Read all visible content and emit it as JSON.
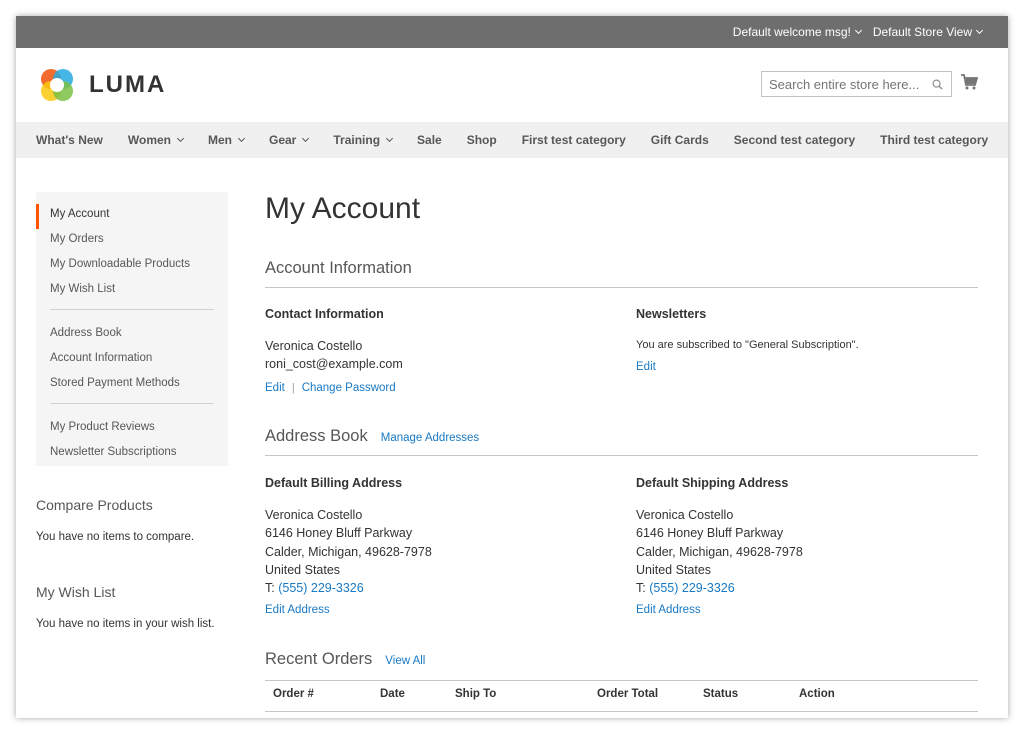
{
  "colors": {
    "accent": "#ff5501",
    "link": "#1979c3",
    "top_bar": "#6e6e6e",
    "nav_bg": "#f0f0f0"
  },
  "top_bar": {
    "welcome": "Default welcome msg!",
    "store_view": "Default Store View"
  },
  "brand": {
    "name": "LUMA"
  },
  "search": {
    "placeholder": "Search entire store here..."
  },
  "nav": [
    "What's New",
    "Women",
    "Men",
    "Gear",
    "Training",
    "Sale",
    "Shop",
    "First test category",
    "Gift Cards",
    "Second test category",
    "Third test category"
  ],
  "sidebar": {
    "groups": [
      [
        "My Account",
        "My Orders",
        "My Downloadable Products",
        "My Wish List"
      ],
      [
        "Address Book",
        "Account Information",
        "Stored Payment Methods"
      ],
      [
        "My Product Reviews",
        "Newsletter Subscriptions"
      ]
    ],
    "compare_title": "Compare Products",
    "compare_text": "You have no items to compare.",
    "wishlist_title": "My Wish List",
    "wishlist_text": "You have no items in your wish list."
  },
  "main": {
    "title": "My Account",
    "account_info": {
      "title": "Account Information",
      "contact_title": "Contact Information",
      "name": "Veronica Costello",
      "email": "roni_cost@example.com",
      "edit": "Edit",
      "change_password": "Change Password",
      "newsletters_title": "Newsletters",
      "newsletters_text": "You are subscribed to \"General Subscription\".",
      "newsletters_edit": "Edit"
    },
    "address_book": {
      "title": "Address Book",
      "manage": "Manage Addresses",
      "billing": {
        "title": "Default Billing Address",
        "name": "Veronica Costello",
        "street": "6146 Honey Bluff Parkway",
        "city": "Calder, Michigan, 49628-7978",
        "country": "United States",
        "phone_prefix": "T:",
        "phone": "(555) 229-3326",
        "edit": "Edit Address"
      },
      "shipping": {
        "title": "Default Shipping Address",
        "name": "Veronica Costello",
        "street": "6146 Honey Bluff Parkway",
        "city": "Calder, Michigan, 49628-7978",
        "country": "United States",
        "phone_prefix": "T:",
        "phone": "(555) 229-3326",
        "edit": "Edit Address"
      }
    },
    "recent_orders": {
      "title": "Recent Orders",
      "view_all": "View All",
      "columns": [
        "Order #",
        "Date",
        "Ship To",
        "Order Total",
        "Status",
        "Action"
      ]
    }
  }
}
